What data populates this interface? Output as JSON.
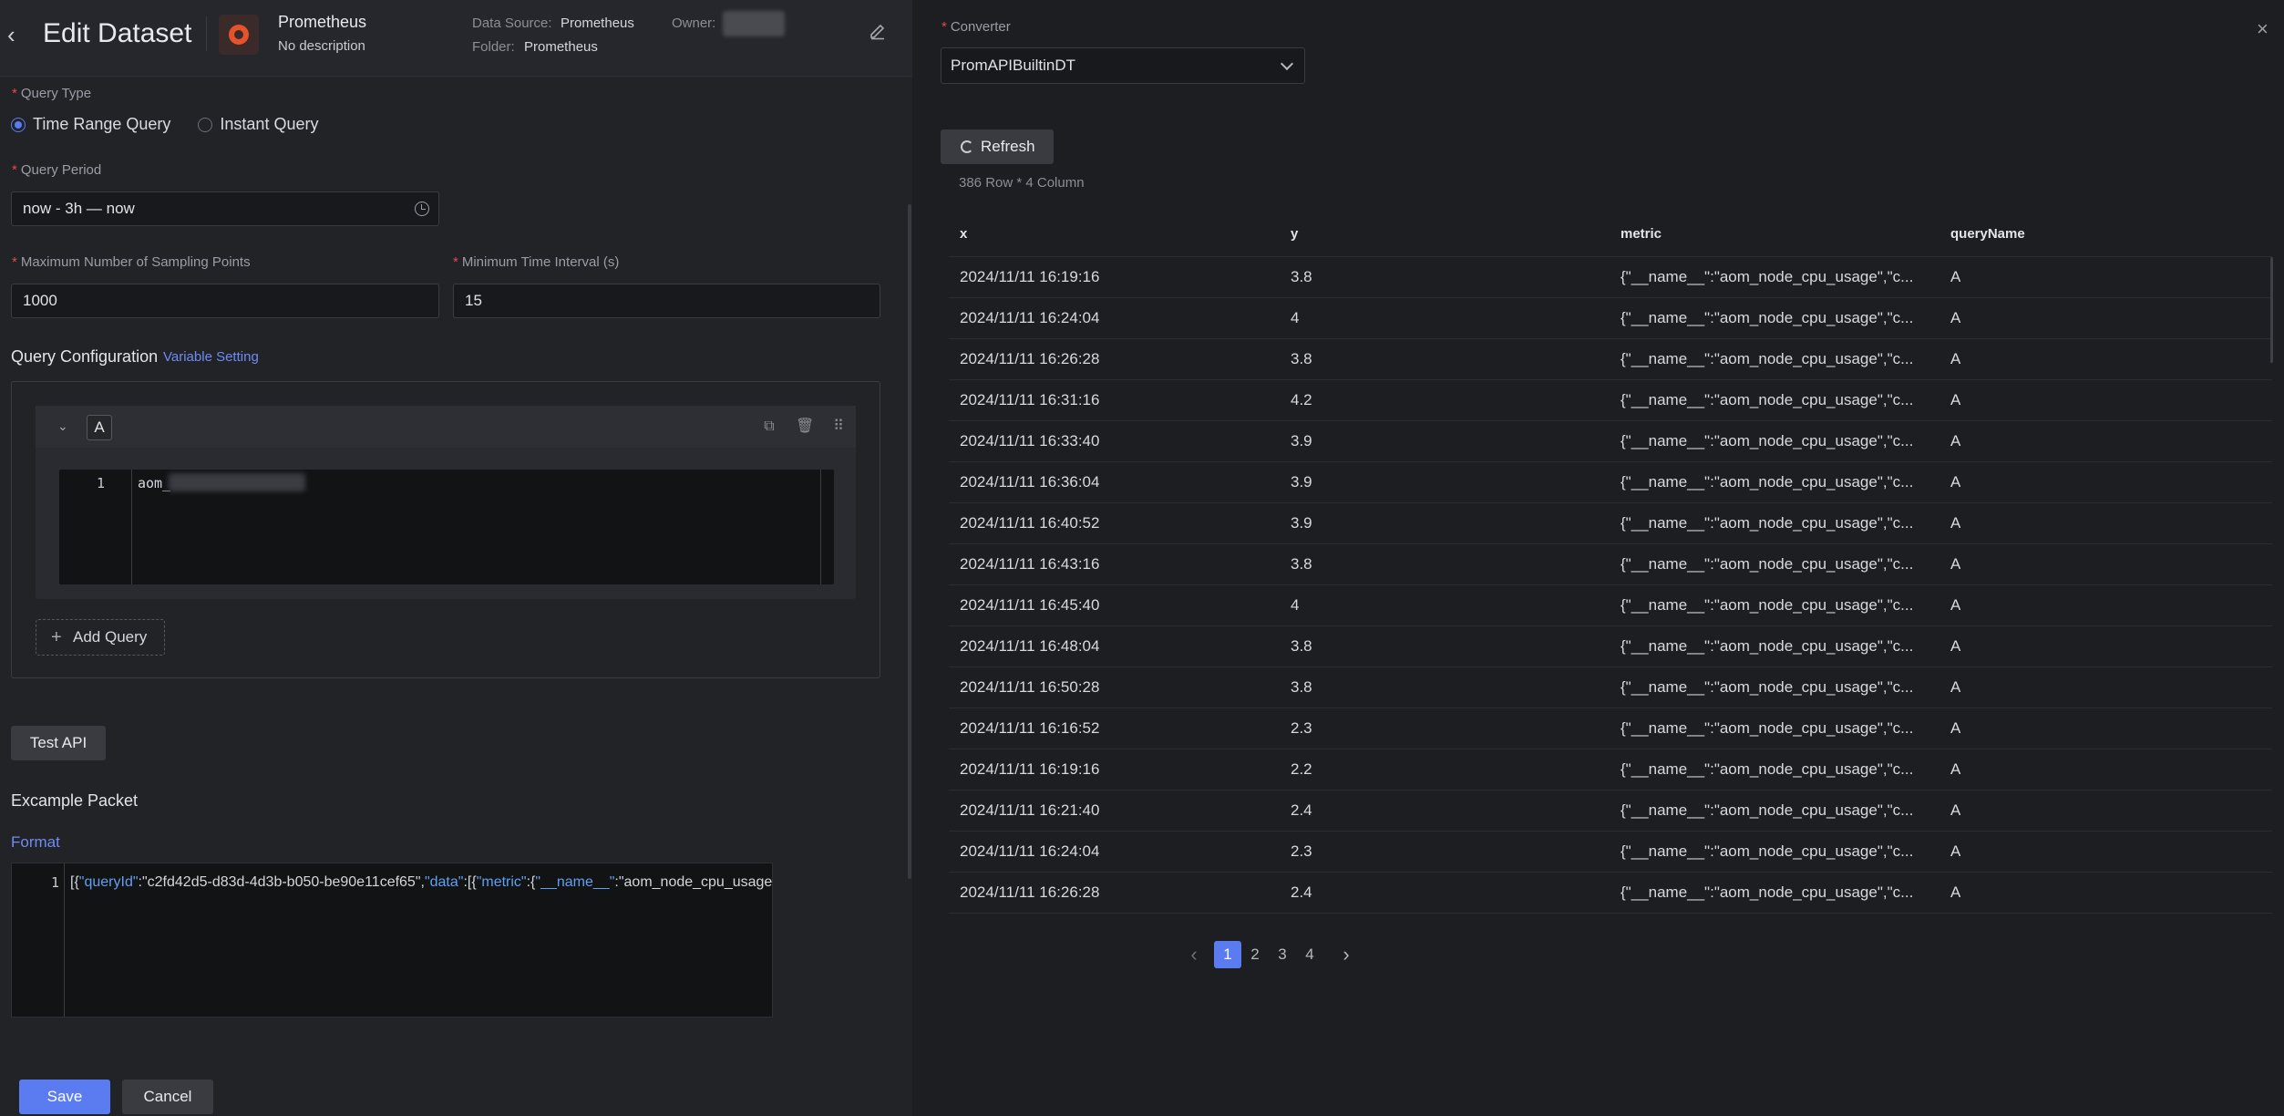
{
  "header": {
    "title": "Edit Dataset",
    "datasource_name": "Prometheus",
    "datasource_desc": "No description",
    "data_source_label": "Data Source:",
    "data_source_value": "Prometheus",
    "owner_label": "Owner:",
    "folder_label": "Folder:",
    "folder_value": "Prometheus"
  },
  "form": {
    "query_type_label": "Query Type",
    "query_type_options": [
      "Time Range Query",
      "Instant Query"
    ],
    "query_period_label": "Query Period",
    "query_period_value": "now - 3h — now",
    "max_points_label": "Maximum Number of Sampling Points",
    "max_points_value": "1000",
    "min_interval_label": "Minimum Time Interval (s)",
    "min_interval_value": "15",
    "query_config_label": "Query Configuration",
    "variable_setting": "Variable Setting",
    "query_tag": "A",
    "editor_line": "1",
    "editor_code": "aom_",
    "add_query": "Add Query",
    "test_api": "Test API",
    "example_packet": "Excample Packet",
    "format": "Format",
    "packet_line": "1",
    "packet_parts": {
      "p1": "[{",
      "k1": "\"queryId\"",
      "p2": ":\"c2fd42d5-d83d-4d3b-b050-be90e11cef65\",",
      "k2": "\"data\"",
      "p3": ":[{",
      "k3": "\"metric\"",
      "p4": ":{",
      "k4": "\"__name__\"",
      "p5": ":\"aom_node_cpu_usage\""
    },
    "save": "Save",
    "cancel": "Cancel"
  },
  "right": {
    "converter_label": "Converter",
    "converter_value": "PromAPIBuiltinDT",
    "refresh": "Refresh",
    "row_count": "386 Row * 4 Column",
    "columns": [
      "x",
      "y",
      "metric",
      "queryName"
    ],
    "rows": [
      [
        "2024/11/11 16:19:16",
        "3.8",
        "{\"__name__\":\"aom_node_cpu_usage\",\"c...",
        "A"
      ],
      [
        "2024/11/11 16:24:04",
        "4",
        "{\"__name__\":\"aom_node_cpu_usage\",\"c...",
        "A"
      ],
      [
        "2024/11/11 16:26:28",
        "3.8",
        "{\"__name__\":\"aom_node_cpu_usage\",\"c...",
        "A"
      ],
      [
        "2024/11/11 16:31:16",
        "4.2",
        "{\"__name__\":\"aom_node_cpu_usage\",\"c...",
        "A"
      ],
      [
        "2024/11/11 16:33:40",
        "3.9",
        "{\"__name__\":\"aom_node_cpu_usage\",\"c...",
        "A"
      ],
      [
        "2024/11/11 16:36:04",
        "3.9",
        "{\"__name__\":\"aom_node_cpu_usage\",\"c...",
        "A"
      ],
      [
        "2024/11/11 16:40:52",
        "3.9",
        "{\"__name__\":\"aom_node_cpu_usage\",\"c...",
        "A"
      ],
      [
        "2024/11/11 16:43:16",
        "3.8",
        "{\"__name__\":\"aom_node_cpu_usage\",\"c...",
        "A"
      ],
      [
        "2024/11/11 16:45:40",
        "4",
        "{\"__name__\":\"aom_node_cpu_usage\",\"c...",
        "A"
      ],
      [
        "2024/11/11 16:48:04",
        "3.8",
        "{\"__name__\":\"aom_node_cpu_usage\",\"c...",
        "A"
      ],
      [
        "2024/11/11 16:50:28",
        "3.8",
        "{\"__name__\":\"aom_node_cpu_usage\",\"c...",
        "A"
      ],
      [
        "2024/11/11 16:16:52",
        "2.3",
        "{\"__name__\":\"aom_node_cpu_usage\",\"c...",
        "A"
      ],
      [
        "2024/11/11 16:19:16",
        "2.2",
        "{\"__name__\":\"aom_node_cpu_usage\",\"c...",
        "A"
      ],
      [
        "2024/11/11 16:21:40",
        "2.4",
        "{\"__name__\":\"aom_node_cpu_usage\",\"c...",
        "A"
      ],
      [
        "2024/11/11 16:24:04",
        "2.3",
        "{\"__name__\":\"aom_node_cpu_usage\",\"c...",
        "A"
      ],
      [
        "2024/11/11 16:26:28",
        "2.4",
        "{\"__name__\":\"aom_node_cpu_usage\",\"c...",
        "A"
      ]
    ],
    "pages": [
      "1",
      "2",
      "3",
      "4"
    ],
    "prev": "‹",
    "next": "›"
  },
  "colors": {
    "accent": "#5b7cf0",
    "required": "#e5484d",
    "link": "#6e8cf2"
  }
}
